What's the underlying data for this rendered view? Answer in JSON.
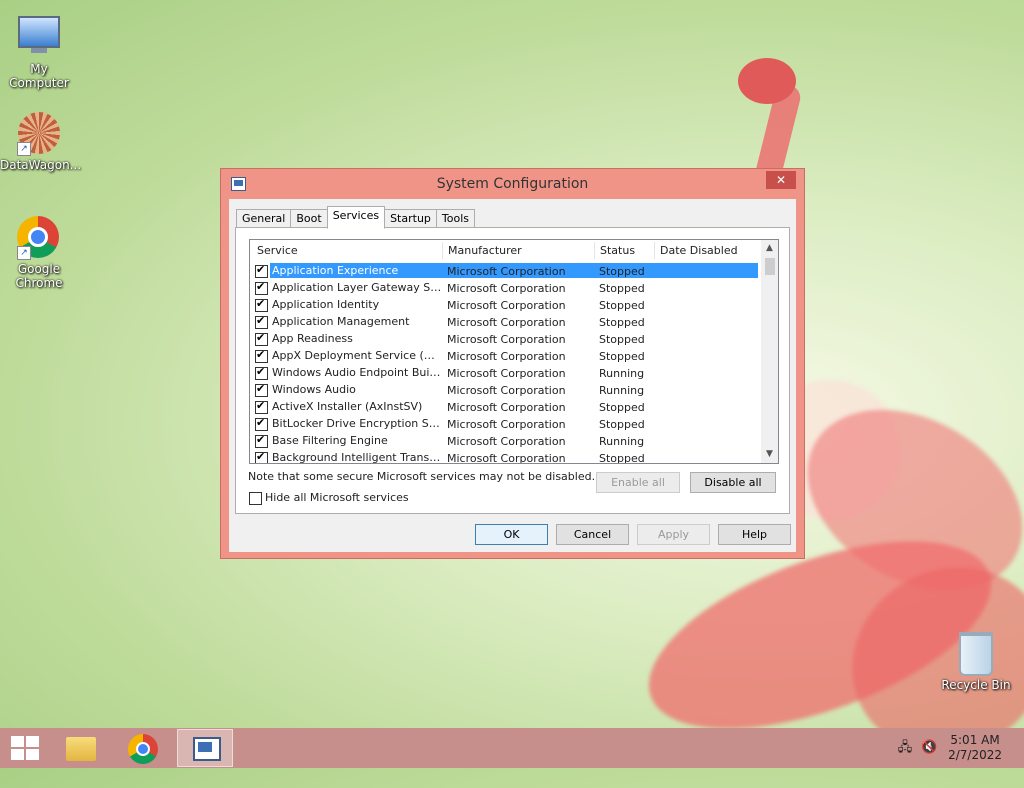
{
  "desktop": {
    "icons": [
      {
        "label": "My Computer"
      },
      {
        "label": "DataWagon..."
      },
      {
        "label": "Google Chrome"
      },
      {
        "label": "Recycle Bin"
      }
    ]
  },
  "window": {
    "title": "System Configuration",
    "close_glyph": "✕",
    "tabs": [
      "General",
      "Boot",
      "Services",
      "Startup",
      "Tools"
    ],
    "active_tab": "Services",
    "columns": [
      "Service",
      "Manufacturer",
      "Status",
      "Date Disabled"
    ],
    "services": [
      {
        "name": "Application Experience",
        "manufacturer": "Microsoft Corporation",
        "status": "Stopped",
        "date_disabled": "",
        "checked": true,
        "selected": true
      },
      {
        "name": "Application Layer Gateway Service",
        "manufacturer": "Microsoft Corporation",
        "status": "Stopped",
        "date_disabled": "",
        "checked": true
      },
      {
        "name": "Application Identity",
        "manufacturer": "Microsoft Corporation",
        "status": "Stopped",
        "date_disabled": "",
        "checked": true
      },
      {
        "name": "Application Management",
        "manufacturer": "Microsoft Corporation",
        "status": "Stopped",
        "date_disabled": "",
        "checked": true
      },
      {
        "name": "App Readiness",
        "manufacturer": "Microsoft Corporation",
        "status": "Stopped",
        "date_disabled": "",
        "checked": true
      },
      {
        "name": "AppX Deployment Service (AppX...",
        "manufacturer": "Microsoft Corporation",
        "status": "Stopped",
        "date_disabled": "",
        "checked": true
      },
      {
        "name": "Windows Audio Endpoint Builder",
        "manufacturer": "Microsoft Corporation",
        "status": "Running",
        "date_disabled": "",
        "checked": true
      },
      {
        "name": "Windows Audio",
        "manufacturer": "Microsoft Corporation",
        "status": "Running",
        "date_disabled": "",
        "checked": true
      },
      {
        "name": "ActiveX Installer (AxInstSV)",
        "manufacturer": "Microsoft Corporation",
        "status": "Stopped",
        "date_disabled": "",
        "checked": true
      },
      {
        "name": "BitLocker Drive Encryption Service",
        "manufacturer": "Microsoft Corporation",
        "status": "Stopped",
        "date_disabled": "",
        "checked": true
      },
      {
        "name": "Base Filtering Engine",
        "manufacturer": "Microsoft Corporation",
        "status": "Running",
        "date_disabled": "",
        "checked": true
      },
      {
        "name": "Background Intelligent Transfer ...",
        "manufacturer": "Microsoft Corporation",
        "status": "Stopped",
        "date_disabled": "",
        "checked": true
      }
    ],
    "scroll_up": "▲",
    "scroll_down": "▼",
    "note": "Note that some secure Microsoft services may not be disabled.",
    "enable_all": "Enable all",
    "disable_all": "Disable all",
    "hide_ms_label": "Hide all Microsoft services",
    "hide_ms_checked": false,
    "buttons": {
      "ok": "OK",
      "cancel": "Cancel",
      "apply": "Apply",
      "help": "Help"
    }
  },
  "taskbar": {
    "apps": [
      "file-explorer",
      "google-chrome",
      "system-configuration"
    ],
    "time": "5:01 AM",
    "date": "2/7/2022",
    "tray_network": "🖧",
    "tray_volume": "🔇"
  },
  "colors": {
    "window_frame": "#f19488",
    "selection": "#3399ff",
    "taskbar": "#c78f8b"
  }
}
